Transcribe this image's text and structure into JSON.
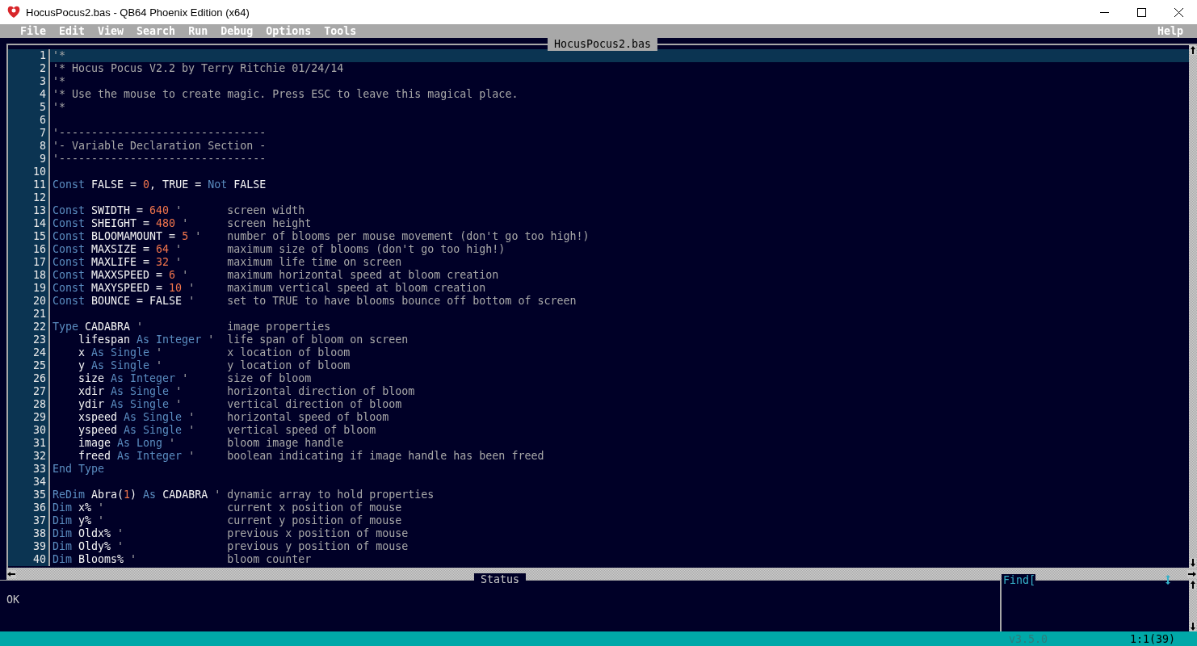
{
  "window": {
    "title": "HocusPocus2.bas - QB64 Phoenix Edition (x64)"
  },
  "menu": [
    {
      "label": "File"
    },
    {
      "label": "Edit"
    },
    {
      "label": "View"
    },
    {
      "label": "Search"
    },
    {
      "label": "Run"
    },
    {
      "label": "Debug"
    },
    {
      "label": "Options"
    },
    {
      "label": "Tools"
    }
  ],
  "help_menu": {
    "label": "Help"
  },
  "editor": {
    "tab_title": "HocusPocus2.bas",
    "lines": [
      {
        "number": "1",
        "current": true,
        "tokens": [
          {
            "kind": "cm",
            "text": "'*"
          }
        ]
      },
      {
        "number": "2",
        "current": false,
        "tokens": [
          {
            "kind": "cm",
            "text": "'* Hocus Pocus V2.2 by Terry Ritchie 01/24/14"
          }
        ]
      },
      {
        "number": "3",
        "current": false,
        "tokens": [
          {
            "kind": "cm",
            "text": "'*"
          }
        ]
      },
      {
        "number": "4",
        "current": false,
        "tokens": [
          {
            "kind": "cm",
            "text": "'* Use the mouse to create magic. Press ESC to leave this magical place."
          }
        ]
      },
      {
        "number": "5",
        "current": false,
        "tokens": [
          {
            "kind": "cm",
            "text": "'*"
          }
        ]
      },
      {
        "number": "6",
        "current": false
      },
      {
        "number": "7",
        "current": false,
        "tokens": [
          {
            "kind": "cm",
            "text": "'--------------------------------"
          }
        ]
      },
      {
        "number": "8",
        "current": false,
        "tokens": [
          {
            "kind": "cm",
            "text": "'- Variable Declaration Section -"
          }
        ]
      },
      {
        "number": "9",
        "current": false,
        "tokens": [
          {
            "kind": "cm",
            "text": "'--------------------------------"
          }
        ]
      },
      {
        "number": "10",
        "current": false
      },
      {
        "number": "11",
        "current": false,
        "tokens": [
          {
            "kind": "kw",
            "text": "Const"
          },
          {
            "kind": "id",
            "text": " FALSE = "
          },
          {
            "kind": "num",
            "text": "0"
          },
          {
            "kind": "id",
            "text": ", TRUE = "
          },
          {
            "kind": "kw",
            "text": "Not"
          },
          {
            "kind": "id",
            "text": " FALSE"
          }
        ]
      },
      {
        "number": "12",
        "current": false
      },
      {
        "number": "13",
        "current": false,
        "tokens": [
          {
            "kind": "kw",
            "text": "Const"
          },
          {
            "kind": "id",
            "text": " SWIDTH = "
          },
          {
            "kind": "num",
            "text": "640"
          },
          {
            "kind": "cm",
            "text": " ' "
          }
        ],
        "comment": "screen width"
      },
      {
        "number": "14",
        "current": false,
        "tokens": [
          {
            "kind": "kw",
            "text": "Const"
          },
          {
            "kind": "id",
            "text": " SHEIGHT = "
          },
          {
            "kind": "num",
            "text": "480"
          },
          {
            "kind": "cm",
            "text": " ' "
          }
        ],
        "comment": "screen height"
      },
      {
        "number": "15",
        "current": false,
        "tokens": [
          {
            "kind": "kw",
            "text": "Const"
          },
          {
            "kind": "id",
            "text": " BLOOMAMOUNT = "
          },
          {
            "kind": "num",
            "text": "5"
          },
          {
            "kind": "cm",
            "text": " ' "
          }
        ],
        "comment": "number of blooms per mouse movement (don't go too high!)"
      },
      {
        "number": "16",
        "current": false,
        "tokens": [
          {
            "kind": "kw",
            "text": "Const"
          },
          {
            "kind": "id",
            "text": " MAXSIZE = "
          },
          {
            "kind": "num",
            "text": "64"
          },
          {
            "kind": "cm",
            "text": " ' "
          }
        ],
        "comment": "maximum size of blooms (don't go too high!)"
      },
      {
        "number": "17",
        "current": false,
        "tokens": [
          {
            "kind": "kw",
            "text": "Const"
          },
          {
            "kind": "id",
            "text": " MAXLIFE = "
          },
          {
            "kind": "num",
            "text": "32"
          },
          {
            "kind": "cm",
            "text": " ' "
          }
        ],
        "comment": "maximum life time on screen"
      },
      {
        "number": "18",
        "current": false,
        "tokens": [
          {
            "kind": "kw",
            "text": "Const"
          },
          {
            "kind": "id",
            "text": " MAXXSPEED = "
          },
          {
            "kind": "num",
            "text": "6"
          },
          {
            "kind": "cm",
            "text": " ' "
          }
        ],
        "comment": "maximum horizontal speed at bloom creation"
      },
      {
        "number": "19",
        "current": false,
        "tokens": [
          {
            "kind": "kw",
            "text": "Const"
          },
          {
            "kind": "id",
            "text": " MAXYSPEED = "
          },
          {
            "kind": "num",
            "text": "10"
          },
          {
            "kind": "cm",
            "text": " ' "
          }
        ],
        "comment": "maximum vertical speed at bloom creation"
      },
      {
        "number": "20",
        "current": false,
        "tokens": [
          {
            "kind": "kw",
            "text": "Const"
          },
          {
            "kind": "id",
            "text": " BOUNCE = FALSE"
          },
          {
            "kind": "cm",
            "text": " ' "
          }
        ],
        "comment": "set to TRUE to have blooms bounce off bottom of screen"
      },
      {
        "number": "21",
        "current": false
      },
      {
        "number": "22",
        "current": false,
        "tokens": [
          {
            "kind": "kw",
            "text": "Type"
          },
          {
            "kind": "id",
            "text": " CADABRA"
          },
          {
            "kind": "cm",
            "text": " ' "
          }
        ],
        "comment": "image properties"
      },
      {
        "number": "23",
        "current": false,
        "tokens": [
          {
            "kind": "id",
            "text": "    lifespan "
          },
          {
            "kind": "kw",
            "text": "As Integer"
          },
          {
            "kind": "cm",
            "text": " ' "
          }
        ],
        "comment": "life span of bloom on screen"
      },
      {
        "number": "24",
        "current": false,
        "tokens": [
          {
            "kind": "id",
            "text": "    x "
          },
          {
            "kind": "kw",
            "text": "As Single"
          },
          {
            "kind": "cm",
            "text": " ' "
          }
        ],
        "comment": "x location of bloom"
      },
      {
        "number": "25",
        "current": false,
        "tokens": [
          {
            "kind": "id",
            "text": "    y "
          },
          {
            "kind": "kw",
            "text": "As Single"
          },
          {
            "kind": "cm",
            "text": " ' "
          }
        ],
        "comment": "y location of bloom"
      },
      {
        "number": "26",
        "current": false,
        "tokens": [
          {
            "kind": "id",
            "text": "    size "
          },
          {
            "kind": "kw",
            "text": "As Integer"
          },
          {
            "kind": "cm",
            "text": " ' "
          }
        ],
        "comment": "size of bloom"
      },
      {
        "number": "27",
        "current": false,
        "tokens": [
          {
            "kind": "id",
            "text": "    xdir "
          },
          {
            "kind": "kw",
            "text": "As Single"
          },
          {
            "kind": "cm",
            "text": " ' "
          }
        ],
        "comment": "horizontal direction of bloom"
      },
      {
        "number": "28",
        "current": false,
        "tokens": [
          {
            "kind": "id",
            "text": "    ydir "
          },
          {
            "kind": "kw",
            "text": "As Single"
          },
          {
            "kind": "cm",
            "text": " ' "
          }
        ],
        "comment": "vertical direction of bloom"
      },
      {
        "number": "29",
        "current": false,
        "tokens": [
          {
            "kind": "id",
            "text": "    xspeed "
          },
          {
            "kind": "kw",
            "text": "As Single"
          },
          {
            "kind": "cm",
            "text": " ' "
          }
        ],
        "comment": "horizontal speed of bloom"
      },
      {
        "number": "30",
        "current": false,
        "tokens": [
          {
            "kind": "id",
            "text": "    yspeed "
          },
          {
            "kind": "kw",
            "text": "As Single"
          },
          {
            "kind": "cm",
            "text": " ' "
          }
        ],
        "comment": "vertical speed of bloom"
      },
      {
        "number": "31",
        "current": false,
        "tokens": [
          {
            "kind": "id",
            "text": "    image "
          },
          {
            "kind": "kw",
            "text": "As Long"
          },
          {
            "kind": "cm",
            "text": " ' "
          }
        ],
        "comment": "bloom image handle"
      },
      {
        "number": "32",
        "current": false,
        "tokens": [
          {
            "kind": "id",
            "text": "    freed "
          },
          {
            "kind": "kw",
            "text": "As Integer"
          },
          {
            "kind": "cm",
            "text": " ' "
          }
        ],
        "comment": "boolean indicating if image handle has been freed"
      },
      {
        "number": "33",
        "current": false,
        "tokens": [
          {
            "kind": "kw",
            "text": "End Type"
          }
        ]
      },
      {
        "number": "34",
        "current": false
      },
      {
        "number": "35",
        "current": false,
        "tokens": [
          {
            "kind": "kw",
            "text": "ReDim"
          },
          {
            "kind": "id",
            "text": " Abra("
          },
          {
            "kind": "num",
            "text": "1"
          },
          {
            "kind": "id",
            "text": ") "
          },
          {
            "kind": "kw",
            "text": "As"
          },
          {
            "kind": "id",
            "text": " CADABRA"
          },
          {
            "kind": "cm",
            "text": " ' "
          }
        ],
        "comment": "dynamic array to hold properties"
      },
      {
        "number": "36",
        "current": false,
        "tokens": [
          {
            "kind": "kw",
            "text": "Dim"
          },
          {
            "kind": "id",
            "text": " x%"
          },
          {
            "kind": "cm",
            "text": " ' "
          }
        ],
        "comment": "current x position of mouse"
      },
      {
        "number": "37",
        "current": false,
        "tokens": [
          {
            "kind": "kw",
            "text": "Dim"
          },
          {
            "kind": "id",
            "text": " y%"
          },
          {
            "kind": "cm",
            "text": " ' "
          }
        ],
        "comment": "current y position of mouse"
      },
      {
        "number": "38",
        "current": false,
        "tokens": [
          {
            "kind": "kw",
            "text": "Dim"
          },
          {
            "kind": "id",
            "text": " Oldx%"
          },
          {
            "kind": "cm",
            "text": " ' "
          }
        ],
        "comment": "previous x position of mouse"
      },
      {
        "number": "39",
        "current": false,
        "tokens": [
          {
            "kind": "kw",
            "text": "Dim"
          },
          {
            "kind": "id",
            "text": " Oldy%"
          },
          {
            "kind": "cm",
            "text": " ' "
          }
        ],
        "comment": "previous y position of mouse"
      },
      {
        "number": "40",
        "current": false,
        "tokens": [
          {
            "kind": "kw",
            "text": "Dim"
          },
          {
            "kind": "id",
            "text": " Blooms%"
          },
          {
            "kind": "cm",
            "text": " ' "
          }
        ],
        "comment": "bloom counter"
      }
    ]
  },
  "status_panel": {
    "title": "Status",
    "message": "OK",
    "find_label": "Find["
  },
  "status_bar": {
    "version": "v3.5.0",
    "cursor_position": "1:1(39)"
  }
}
